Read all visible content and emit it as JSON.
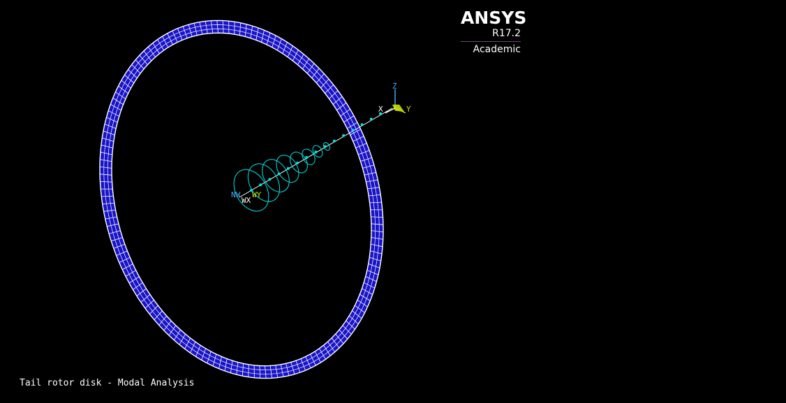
{
  "viewport": {
    "background": "#000000"
  },
  "logo": {
    "name": "ANSYS",
    "release": "R17.2",
    "edition": "Academic"
  },
  "caption": "Tail rotor disk - Modal Analysis",
  "triad": {
    "labels": {
      "x": "X",
      "y": "Y",
      "z": "Z"
    },
    "colors": {
      "x": "#ffffff",
      "y": "#c8e000",
      "z": "#3fa9f5"
    }
  },
  "workplane": {
    "label": "WX",
    "wy_label": "WY",
    "origin_label": "NW"
  },
  "model": {
    "rim_fill": "#1a14c8",
    "mesh_line": "#ffffff",
    "shaft_color": "#00e5e5"
  }
}
